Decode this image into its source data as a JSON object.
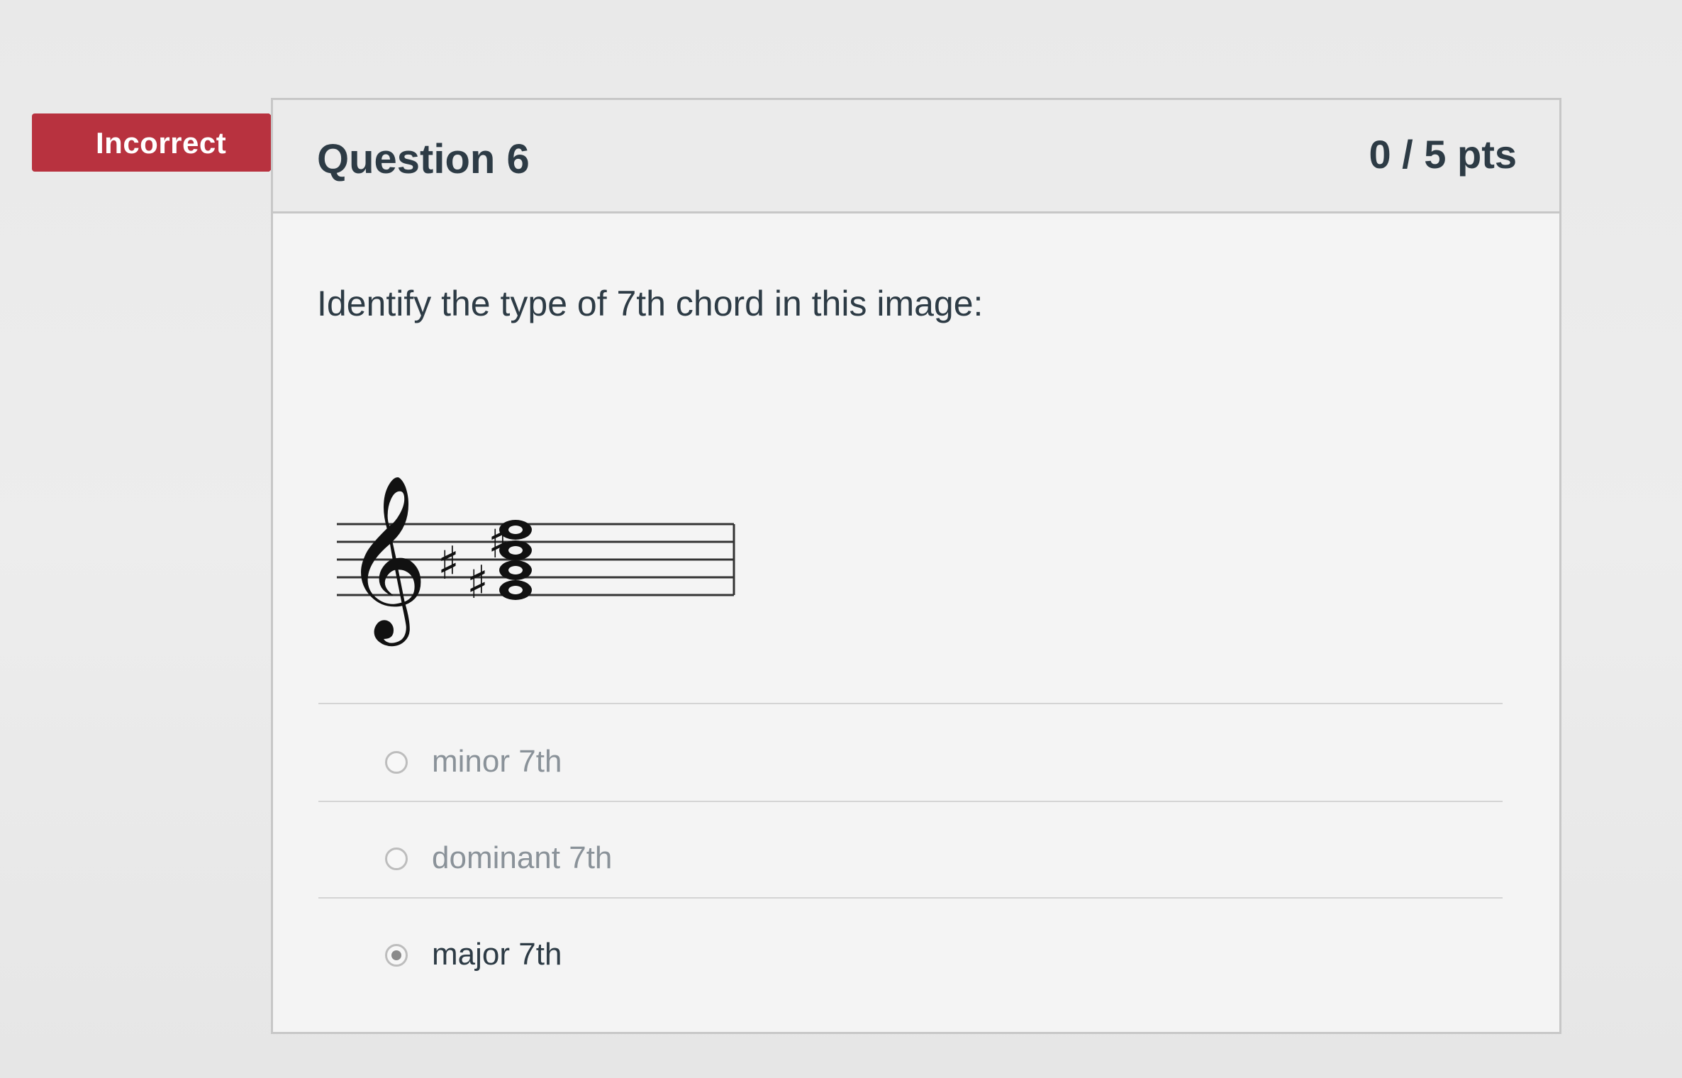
{
  "status_flag": {
    "label": "Incorrect",
    "color": "#b8323f"
  },
  "question": {
    "title": "Question 6",
    "points": "0 / 5 pts",
    "prompt": "Identify the type of 7th chord in this image:"
  },
  "music_image": {
    "clef": "treble-clef-icon",
    "key_signature": "three sharps",
    "chord": "four-note stacked chord with sharp"
  },
  "answers": [
    {
      "label": "minor 7th",
      "selected": false
    },
    {
      "label": "dominant 7th",
      "selected": false
    },
    {
      "label": "major 7th",
      "selected": true
    }
  ]
}
